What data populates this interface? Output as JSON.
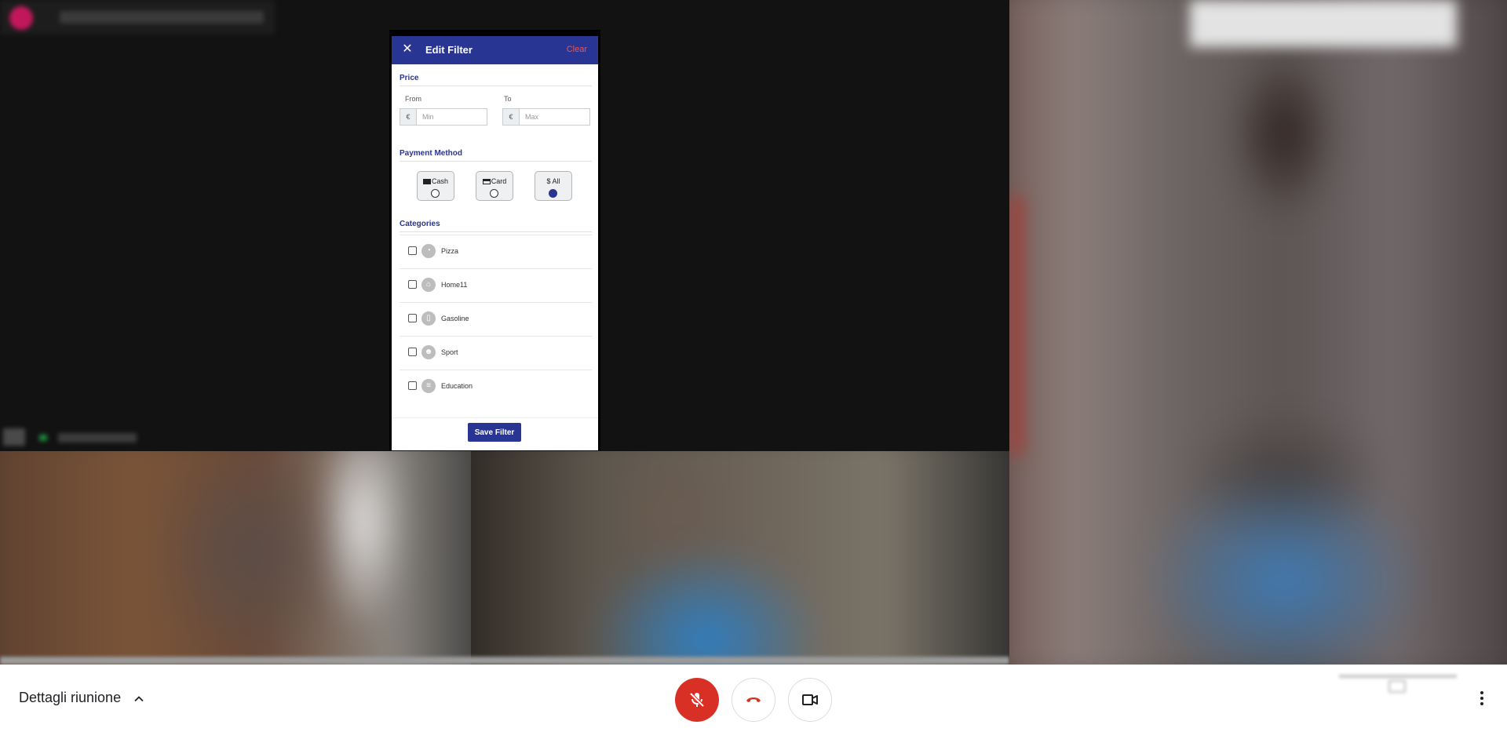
{
  "phone_app": {
    "header": {
      "close_glyph": "✕",
      "title": "Edit Filter",
      "clear_label": "Clear"
    },
    "price": {
      "section_title": "Price",
      "from_label": "From",
      "to_label": "To",
      "currency_symbol": "€",
      "min_placeholder": "Min",
      "max_placeholder": "Max"
    },
    "payment": {
      "section_title": "Payment Method",
      "options": [
        {
          "label": "Cash",
          "icon": "cash-icon",
          "selected": false
        },
        {
          "label": "Card",
          "icon": "card-icon",
          "selected": false
        },
        {
          "label": "$ All",
          "icon": "none",
          "selected": true
        }
      ]
    },
    "categories": {
      "section_title": "Categories",
      "items": [
        {
          "label": "Pizza",
          "icon": "pizza-icon"
        },
        {
          "label": "Home11",
          "icon": "home-icon"
        },
        {
          "label": "Gasoline",
          "icon": "fuel-icon"
        },
        {
          "label": "Sport",
          "icon": "running-icon"
        },
        {
          "label": "Education",
          "icon": "education-icon"
        }
      ]
    },
    "save_label": "Save Filter",
    "colors": {
      "primary": "#283593",
      "clear": "#ef5350"
    }
  },
  "controls": {
    "meeting_details_label": "Dettagli riunione",
    "mic_color": "#d93025",
    "hangup_icon_color": "#d93025"
  }
}
